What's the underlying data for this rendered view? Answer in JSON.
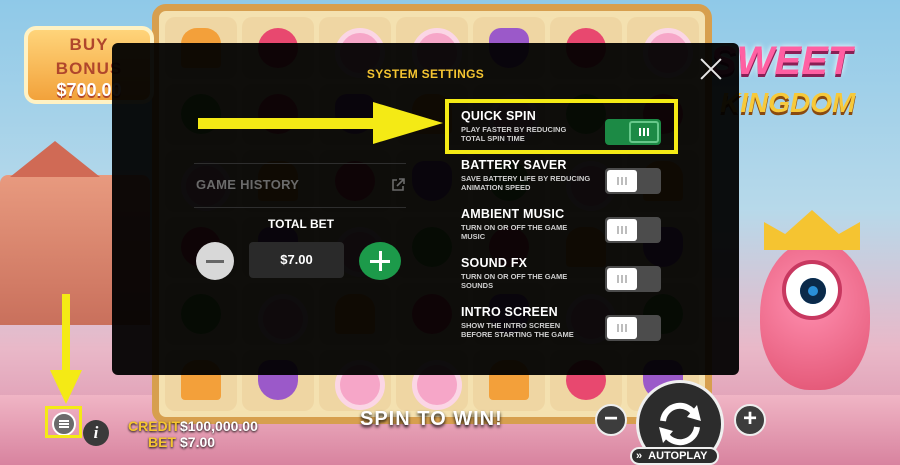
{
  "game": {
    "buy_bonus": {
      "title_line1": "BUY",
      "title_line2": "BONUS",
      "price": "$700.00"
    },
    "logo": {
      "line1": "SWEET",
      "line2": "KINGDOM"
    },
    "credit_label": "CREDIT",
    "credit_value": "$100,000.00",
    "bet_label": "BET",
    "bet_value": "$7.00",
    "banner": "SPIN TO WIN!",
    "autoplay_label": "AUTOPLAY"
  },
  "settings_modal": {
    "title": "SYSTEM SETTINGS",
    "game_history_label": "GAME HISTORY",
    "total_bet_label": "TOTAL BET",
    "total_bet_value": "$7.00",
    "options": [
      {
        "title": "QUICK SPIN",
        "description": "PLAY FASTER BY REDUCING TOTAL SPIN TIME",
        "enabled": true
      },
      {
        "title": "BATTERY SAVER",
        "description": "SAVE BATTERY LIFE BY REDUCING ANIMATION SPEED",
        "enabled": false
      },
      {
        "title": "AMBIENT MUSIC",
        "description": "TURN ON OR OFF THE GAME MUSIC",
        "enabled": false
      },
      {
        "title": "SOUND FX",
        "description": "TURN ON OR OFF THE GAME SOUNDS",
        "enabled": false
      },
      {
        "title": "INTRO SCREEN",
        "description": "SHOW THE INTRO SCREEN BEFORE STARTING THE GAME",
        "enabled": false
      }
    ]
  },
  "icons": {
    "close": "close-icon",
    "external_link": "external-link-icon",
    "menu": "menu-icon",
    "info": "info-icon",
    "spin": "spin-arrows-icon",
    "autoplay": "fast-forward-icon"
  },
  "colors": {
    "accent_yellow": "#f5c531",
    "toggle_on": "#1c8a45",
    "plus_button": "#1c9a4a",
    "annotation": "#f4ea15"
  }
}
